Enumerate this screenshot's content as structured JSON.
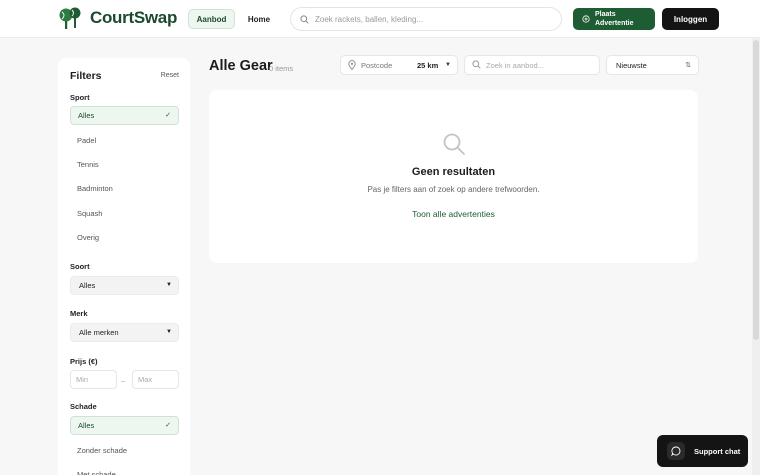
{
  "brand": {
    "name": "CourtSwap",
    "color": "#1e5c33",
    "logo_icon": "balls-logo-icon"
  },
  "nav": {
    "aanbod": "Aanbod",
    "home": "Home"
  },
  "top_search": {
    "placeholder": "Zoek rackets, ballen, kleding...",
    "icon": "search-icon"
  },
  "actions": {
    "plaats_line1": "Plaats",
    "plaats_line2": "Advertentie",
    "login": "Inloggen"
  },
  "filters": {
    "title": "Filters",
    "reset": "Reset",
    "sport": {
      "label": "Sport",
      "options": [
        "Alles",
        "Padel",
        "Tennis",
        "Badminton",
        "Squash",
        "Overig"
      ],
      "selected": "Alles"
    },
    "soort": {
      "label": "Soort",
      "value": "Alles"
    },
    "merk": {
      "label": "Merk",
      "value": "Alle merken"
    },
    "prijs": {
      "label": "Prijs (€)",
      "min_placeholder": "Min",
      "max_placeholder": "Max",
      "separator": "–"
    },
    "schade": {
      "label": "Schade",
      "options": [
        "Alles",
        "Zonder schade",
        "Met schade"
      ],
      "selected": "Alles"
    }
  },
  "main": {
    "title": "Alle Gear",
    "count": "0 items",
    "location": {
      "placeholder": "Postcode",
      "radius": "25 km"
    },
    "search_placeholder": "Zoek in aanbod...",
    "sort": "Nieuwste",
    "empty": {
      "title": "Geen resultaten",
      "subtitle": "Pas je filters aan of zoek op andere trefwoorden.",
      "link": "Toon alle advertenties"
    }
  },
  "support": {
    "label": "Support chat"
  }
}
